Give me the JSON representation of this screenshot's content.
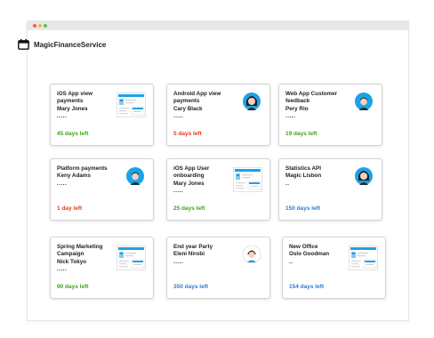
{
  "app": {
    "title": "MagicFinanceService"
  },
  "colors": {
    "green": "#3fa31c",
    "red": "#e03a1a",
    "blue": "#2c7bd4",
    "accent": "#1aa3e8"
  },
  "cards": [
    {
      "lines": [
        "iOS App view",
        "payments",
        "Mary Jones",
        "....."
      ],
      "days": "45 days left",
      "status": "green",
      "media": "screenshot-thumbnail"
    },
    {
      "lines": [
        "Android App view",
        "payments",
        "Cary Black",
        "....."
      ],
      "days": "5 days left",
      "status": "red",
      "media": "avatar-woman"
    },
    {
      "lines": [
        "Web App Customer",
        "feedback",
        "Pery Rio",
        "....."
      ],
      "days": "19  days left",
      "status": "green",
      "media": "avatar-man"
    },
    {
      "lines": [
        "Platform payments",
        "Keny Adams",
        "....."
      ],
      "days": "1 day left",
      "status": "red",
      "media": "avatar-man"
    },
    {
      "lines": [
        "iOS App User",
        "onboarding",
        "Mary Jones",
        "....."
      ],
      "days": "25 days left",
      "status": "green",
      "media": "screenshot-thumbnail"
    },
    {
      "lines": [
        "Statistics API",
        "Magic Lisbon",
        ".."
      ],
      "days": "150 days left",
      "status": "blue",
      "media": "avatar-woman"
    },
    {
      "lines": [
        "Spring Marketing",
        "Campaign",
        "Nick Tokyo",
        "....."
      ],
      "days": "90 days left",
      "status": "green",
      "media": "screenshot-thumbnail"
    },
    {
      "lines": [
        "End year Party",
        "Eleni Nirobi",
        "....."
      ],
      "days": "350 days left",
      "status": "blue",
      "media": "avatar-person"
    },
    {
      "lines": [
        "New Office",
        "Oslo Goodman",
        ".."
      ],
      "days": "154 days left",
      "status": "blue",
      "media": "screenshot-thumbnail"
    }
  ]
}
